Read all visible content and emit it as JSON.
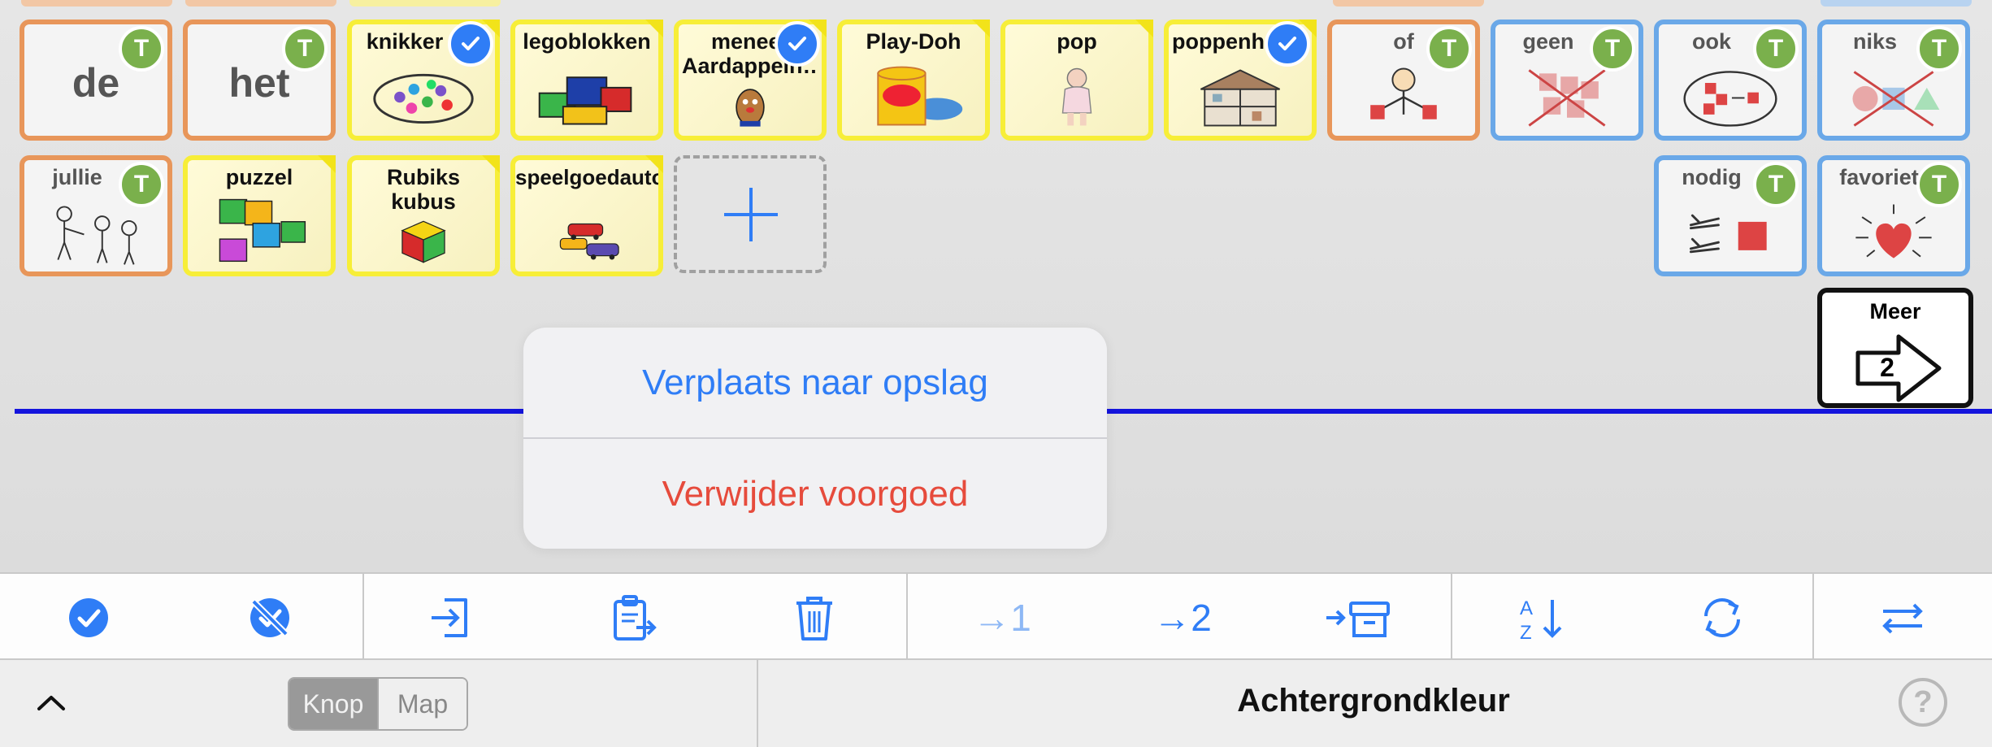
{
  "grid": {
    "row1": [
      {
        "label": "de",
        "style": "orange",
        "badge": "t",
        "pic": "none",
        "big": true
      },
      {
        "label": "het",
        "style": "orange",
        "badge": "t",
        "pic": "none",
        "big": true
      },
      {
        "label": "knikker",
        "style": "yellow",
        "badge": "check",
        "pic": "marbles-icon"
      },
      {
        "label": "legoblokken",
        "style": "yellow",
        "badge": "none",
        "pic": "lego-icon"
      },
      {
        "label": "meneer Aardappelh…",
        "style": "yellow",
        "badge": "check",
        "pic": "potato-head-icon",
        "wrap": true
      },
      {
        "label": "Play-Doh",
        "style": "yellow",
        "badge": "none",
        "pic": "playdoh-icon"
      },
      {
        "label": "pop",
        "style": "yellow",
        "badge": "none",
        "pic": "doll-icon"
      },
      {
        "label": "poppenhuis",
        "style": "yellow",
        "badge": "check",
        "pic": "dollhouse-icon"
      },
      {
        "label": "of",
        "style": "orange",
        "badge": "t",
        "pic": "person-choice-icon"
      },
      {
        "label": "geen",
        "style": "blue",
        "badge": "t",
        "pic": "none-crossed-icon"
      },
      {
        "label": "ook",
        "style": "blue",
        "badge": "t",
        "pic": "also-icon"
      },
      {
        "label": "niks",
        "style": "blue",
        "badge": "t",
        "pic": "nothing-icon"
      }
    ],
    "row2": [
      {
        "label": "jullie",
        "style": "orange",
        "badge": "t",
        "pic": "people-icon"
      },
      {
        "label": "puzzel",
        "style": "yellow",
        "badge": "none",
        "pic": "puzzle-icon"
      },
      {
        "label": "Rubiks kubus",
        "style": "yellow",
        "badge": "none",
        "pic": "rubiks-icon",
        "wrap": true
      },
      {
        "label": "speelgoedautootjes",
        "style": "yellow",
        "badge": "none",
        "pic": "toy-cars-icon",
        "wrap": true
      },
      {
        "label": "nodig",
        "style": "blue",
        "badge": "t",
        "pic": "need-icon"
      },
      {
        "label": "favoriet",
        "style": "blue",
        "badge": "t",
        "pic": "heart-icon"
      }
    ],
    "badge_letter": "T",
    "more": {
      "label": "Meer",
      "page": "2"
    }
  },
  "popover": {
    "move_label": "Verplaats naar opslag",
    "delete_label": "Verwijder voorgoed"
  },
  "toolbar": {
    "move_to_1": "→1",
    "move_to_2": "→2"
  },
  "footer": {
    "seg_knop": "Knop",
    "seg_map": "Map",
    "title": "Achtergrondkleur",
    "help": "?"
  },
  "colors": {
    "accent": "#2f7df6",
    "danger": "#e64b3c",
    "badge_green": "#7ab04c",
    "divider_blue": "#1414dd"
  }
}
